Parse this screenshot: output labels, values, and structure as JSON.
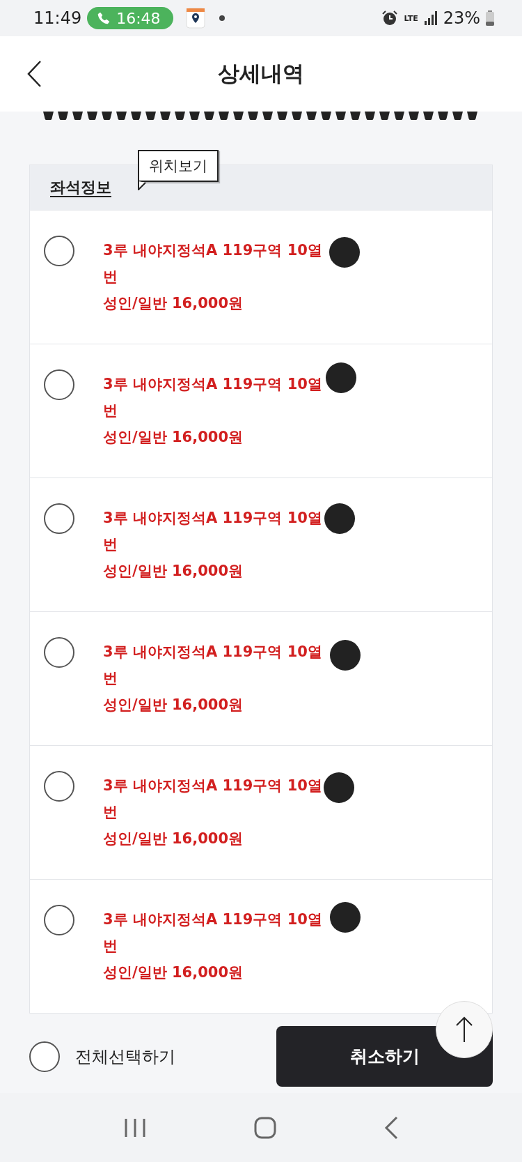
{
  "status_bar": {
    "time": "11:49",
    "call_time": "16:48",
    "network": "LTE",
    "battery": "23%"
  },
  "header": {
    "title": "상세내역"
  },
  "seat_info": {
    "title": "좌석정보",
    "tooltip": "위치보기",
    "seats": [
      {
        "line_1": "3루 내야지정석A 119구역 10열",
        "line_2": "번",
        "price": "성인/일반 16,000원",
        "selected": false
      },
      {
        "line_1": "3루 내야지정석A 119구역 10열",
        "line_2": "번",
        "price": "성인/일반 16,000원",
        "selected": false
      },
      {
        "line_1": "3루 내야지정석A 119구역 10열",
        "line_2": "번",
        "price": "성인/일반 16,000원",
        "selected": false
      },
      {
        "line_1": "3루 내야지정석A 119구역 10열",
        "line_2": "번",
        "price": "성인/일반 16,000원",
        "selected": false
      },
      {
        "line_1": "3루 내야지정석A 119구역 10열",
        "line_2": "번",
        "price": "성인/일반 16,000원",
        "selected": false
      },
      {
        "line_1": "3루 내야지정석A 119구역 10열",
        "line_2": "번",
        "price": "성인/일반 16,000원",
        "selected": false
      }
    ]
  },
  "select_all": {
    "label": "전체선택하기",
    "checked": false
  },
  "cancel_button": "취소하기"
}
